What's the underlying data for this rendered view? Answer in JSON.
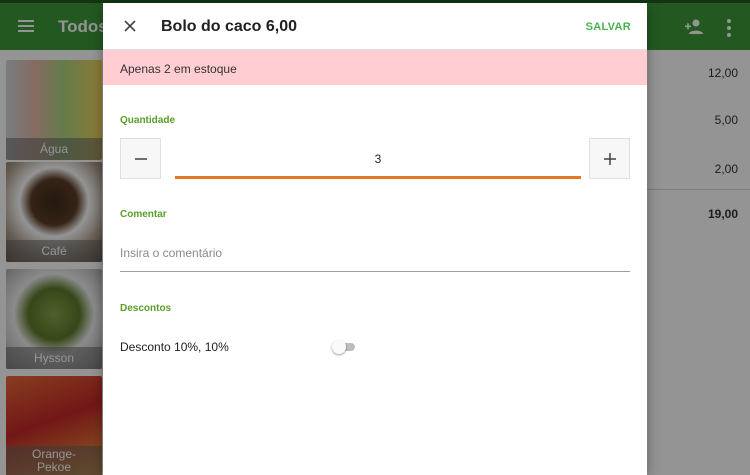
{
  "app": {
    "title": "Todos",
    "products": [
      {
        "label": "Água"
      },
      {
        "label": "Café"
      },
      {
        "label": "Hysson"
      },
      {
        "label": "Orange-\nPekoe"
      }
    ],
    "order": {
      "line_totals": [
        "12,00",
        "5,00",
        "2,00"
      ],
      "total": "19,00"
    }
  },
  "dialog": {
    "title": "Bolo do caco 6,00",
    "save_label": "SALVAR",
    "stock_warning": "Apenas 2 em estoque",
    "quantity_label": "Quantidade",
    "quantity_value": "3",
    "comment_label": "Comentar",
    "comment_placeholder": "Insira o comentário",
    "discounts_label": "Descontos",
    "discounts": [
      {
        "label": "Desconto 10%, 10%",
        "enabled": false
      }
    ]
  },
  "colors": {
    "app_bar": "#3d9a3a",
    "accent_green": "#4caf50",
    "warning_banner": "#ffcdd2",
    "quantity_underline": "#e87722"
  }
}
